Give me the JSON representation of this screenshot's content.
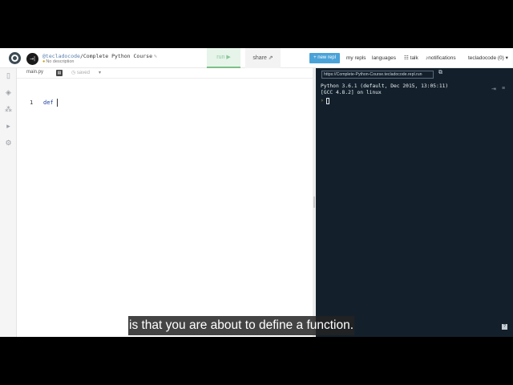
{
  "header": {
    "avatar_text": "→|",
    "repl_user": "@tecladocode",
    "repl_separator": "/",
    "repl_name": "Complete Python Course",
    "description": "No description",
    "run_label": "run ▶",
    "share_label": "share",
    "new_repl_label": "+ new repl",
    "my_repls_label": "my repls",
    "languages_label": "languages",
    "talk_label": "talk",
    "notifications_label": "notifications",
    "user_menu_label": "tecladocode (0) ▾"
  },
  "editor": {
    "file_name": "main.py",
    "saved_label": "saved",
    "line_number": "1",
    "code": "def "
  },
  "console": {
    "url": "https://Complete-Python-Course.tecladocode.repl.run",
    "lines": [
      "Python 3.6.1 (default, Dec 2015, 13:05:11)",
      "[GCC 4.8.2] on linux"
    ],
    "prompt": "›"
  },
  "subtitle": "is that you are about to define a function.",
  "colors": {
    "accent": "#4aa3d8",
    "console_bg": "#13202c",
    "run_bg": "#e6f4ea"
  }
}
